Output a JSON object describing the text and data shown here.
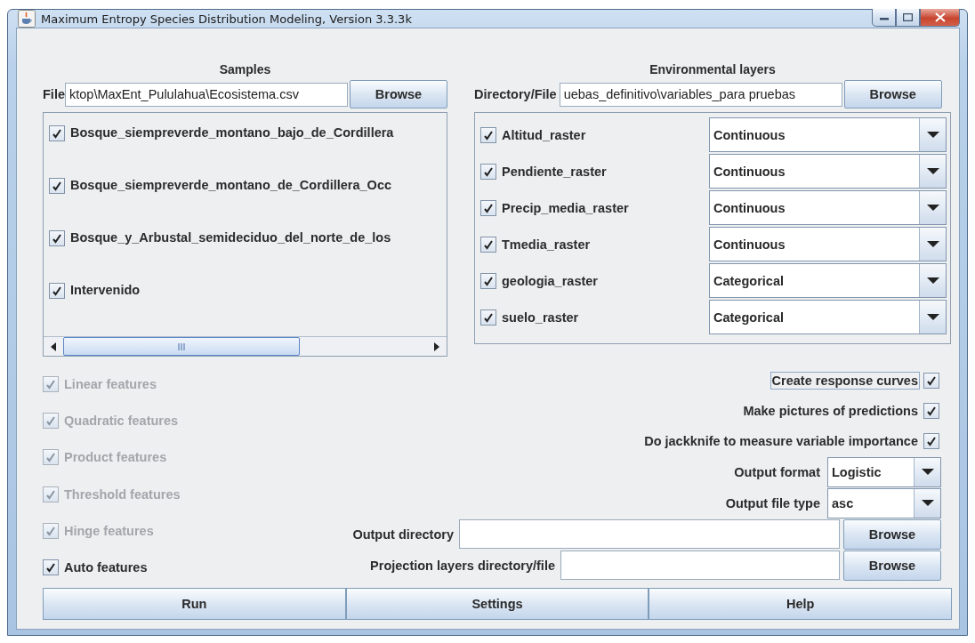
{
  "window": {
    "title": "Maximum Entropy Species Distribution Modeling, Version 3.3.3k"
  },
  "samples": {
    "heading": "Samples",
    "file_label": "File",
    "file_value": "ktop\\MaxEnt_Pululahua\\Ecosistema.csv",
    "browse": "Browse",
    "items": [
      {
        "label": "Bosque_siempreverde_montano_bajo_de_Cordillera",
        "checked": true
      },
      {
        "label": "Bosque_siempreverde_montano_de_Cordillera_Occ",
        "checked": true
      },
      {
        "label": "Bosque_y_Arbustal_semideciduo_del_norte_de_los",
        "checked": true
      },
      {
        "label": "Intervenido",
        "checked": true
      }
    ]
  },
  "environmental_layers": {
    "heading": "Environmental layers",
    "directory_label": "Directory/File",
    "directory_value": "uebas_definitivo\\variables_para pruebas",
    "browse": "Browse",
    "layers": [
      {
        "name": "Altitud_raster",
        "checked": true,
        "type": "Continuous"
      },
      {
        "name": "Pendiente_raster",
        "checked": true,
        "type": "Continuous"
      },
      {
        "name": "Precip_media_raster",
        "checked": true,
        "type": "Continuous"
      },
      {
        "name": "Tmedia_raster",
        "checked": true,
        "type": "Continuous"
      },
      {
        "name": "geologia_raster",
        "checked": true,
        "type": "Categorical"
      },
      {
        "name": "suelo_raster",
        "checked": true,
        "type": "Categorical"
      }
    ]
  },
  "features": [
    {
      "label": "Linear features",
      "checked": true,
      "disabled": true
    },
    {
      "label": "Quadratic features",
      "checked": true,
      "disabled": true
    },
    {
      "label": "Product features",
      "checked": true,
      "disabled": true
    },
    {
      "label": "Threshold features",
      "checked": true,
      "disabled": true
    },
    {
      "label": "Hinge features",
      "checked": true,
      "disabled": true
    },
    {
      "label": "Auto features",
      "checked": true,
      "disabled": false
    }
  ],
  "options": [
    {
      "label": "Create response curves",
      "checked": true,
      "focused": true
    },
    {
      "label": "Make pictures of predictions",
      "checked": true,
      "focused": false
    },
    {
      "label": "Do jackknife to measure variable importance",
      "checked": true,
      "focused": false
    }
  ],
  "selects": [
    {
      "label": "Output format",
      "value": "Logistic"
    },
    {
      "label": "Output file type",
      "value": "asc"
    }
  ],
  "paths": [
    {
      "label": "Output directory",
      "browse": "Browse"
    },
    {
      "label": "Projection layers directory/file",
      "browse": "Browse"
    }
  ],
  "buttons": [
    "Run",
    "Settings",
    "Help"
  ]
}
